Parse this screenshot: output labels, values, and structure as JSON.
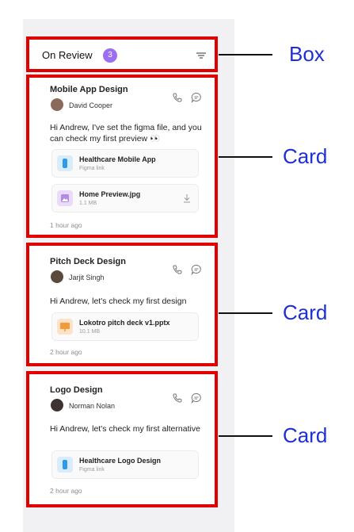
{
  "header": {
    "title": "On Review",
    "count": "3"
  },
  "cards": [
    {
      "title": "Mobile App Design",
      "person": "David Cooper",
      "message": "Hi Andrew, I've set the figma file, and you can check my first preview 👀",
      "files": [
        {
          "name": "Healthcare Mobile App",
          "meta": "Figma link",
          "icon": "figma-icon"
        },
        {
          "name": "Home Preview.jpg",
          "meta": "1.1 MB",
          "icon": "image-icon"
        }
      ],
      "time": "1 hour ago"
    },
    {
      "title": "Pitch Deck Design",
      "person": "Jarjit Singh",
      "message": "Hi Andrew, let's check my first design",
      "files": [
        {
          "name": "Lokotro pitch deck v1.pptx",
          "meta": "10.1 MB",
          "icon": "presentation-icon"
        }
      ],
      "time": "2 hour ago"
    },
    {
      "title": "Logo Design",
      "person": "Norman Nolan",
      "message": "Hi Andrew, let's check my first alternative",
      "files": [
        {
          "name": "Healthcare Logo Design",
          "meta": "Figma link",
          "icon": "figma-icon"
        }
      ],
      "time": "2 hour ago"
    }
  ],
  "annotations": {
    "box": "Box",
    "card1": "Card",
    "card2": "Card",
    "card3": "Card"
  },
  "colors": {
    "highlight": "#e00000",
    "annotation_text": "#1e2fd6",
    "badge": "#9b6ff0"
  }
}
